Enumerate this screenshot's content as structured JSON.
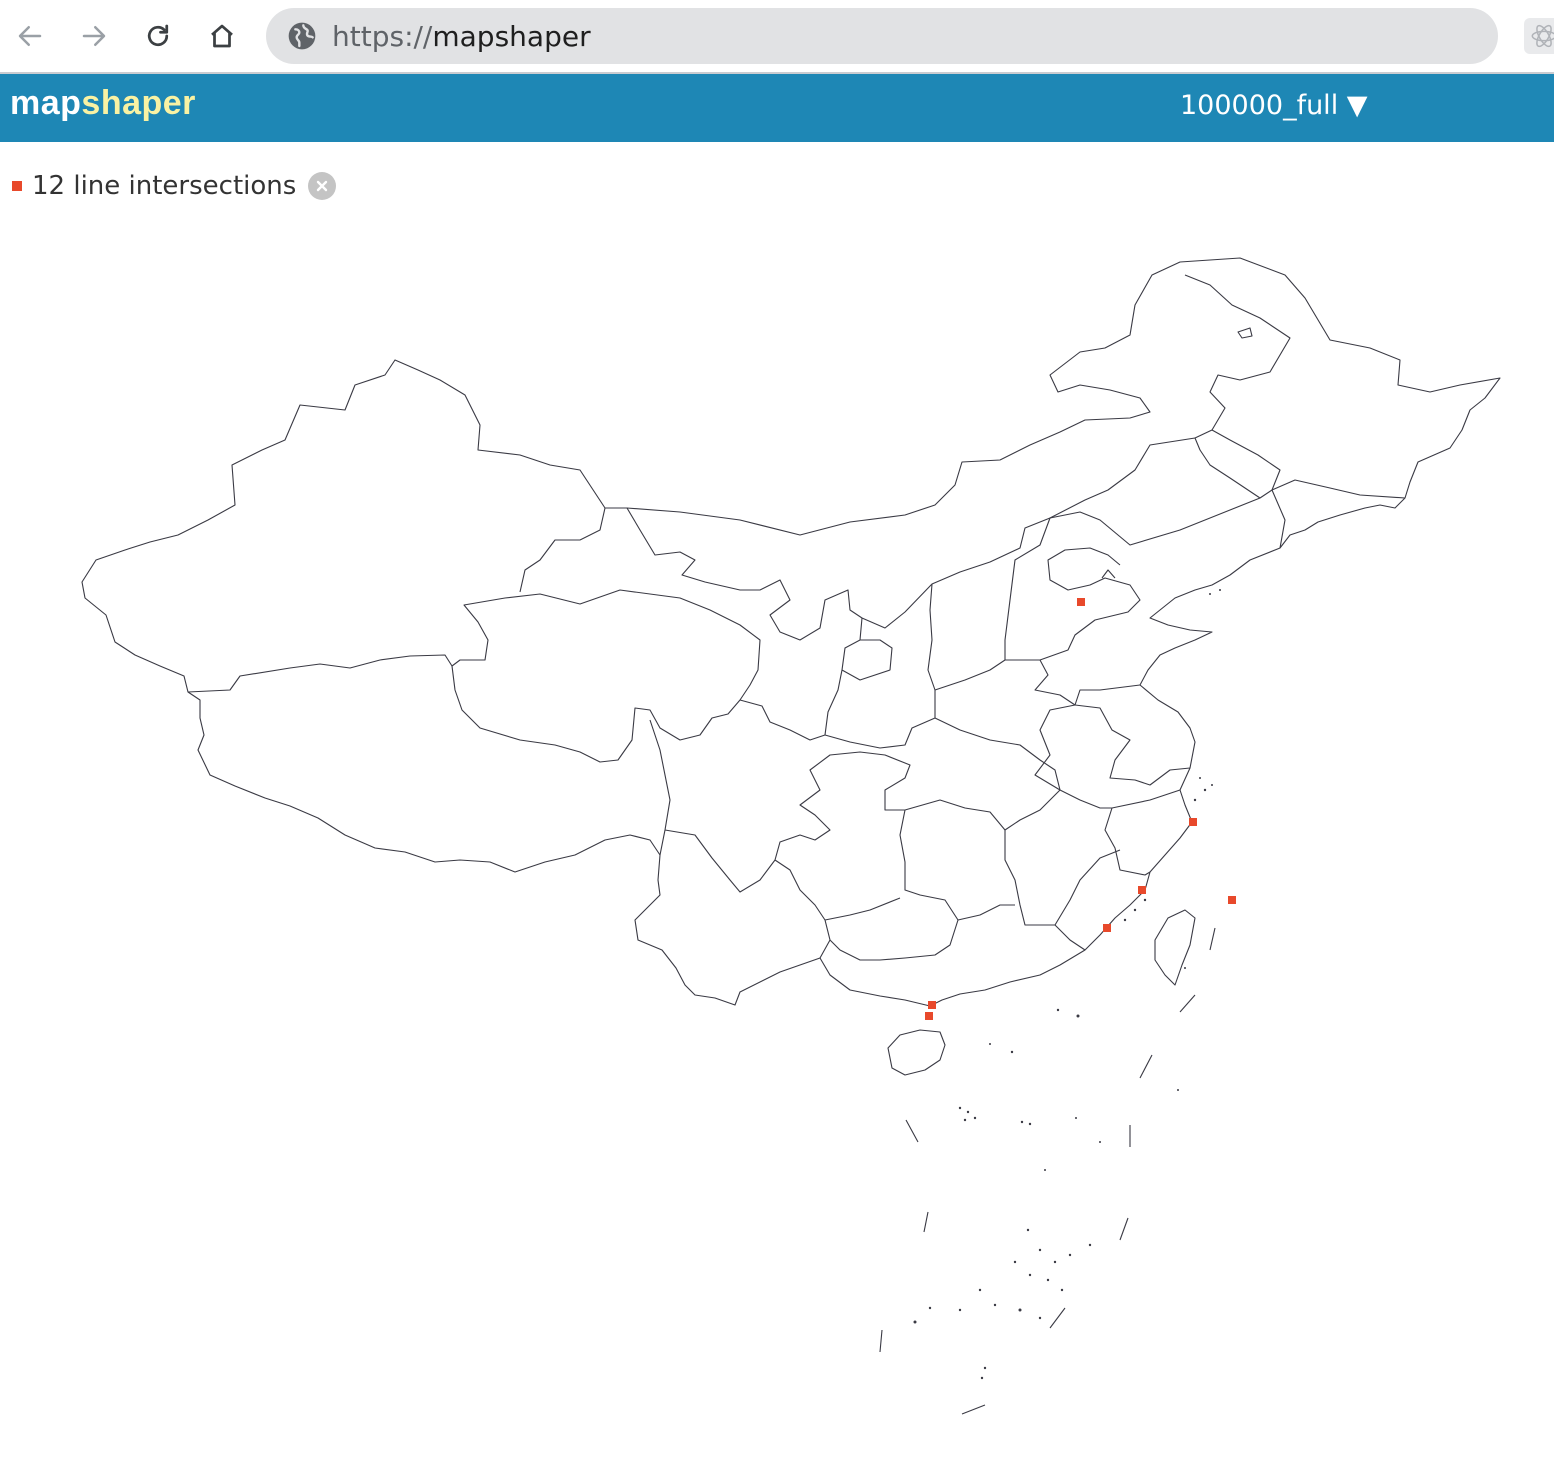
{
  "browser": {
    "url_scheme": "https://",
    "url_host": "mapshaper",
    "icons": [
      "back-arrow-icon",
      "forward-arrow-icon",
      "reload-icon",
      "home-icon",
      "globe-icon",
      "extension-icon"
    ]
  },
  "app": {
    "logo_part1": "map",
    "logo_part2": "shaper",
    "layer_name": "100000_full ▼"
  },
  "intersections": {
    "label": "12 line intersections",
    "marker_color": "#e8492b"
  },
  "colors": {
    "header_bg": "#1e87b5",
    "logo_accent": "#f9f2a3",
    "boundary_stroke": "#3a3a44"
  }
}
